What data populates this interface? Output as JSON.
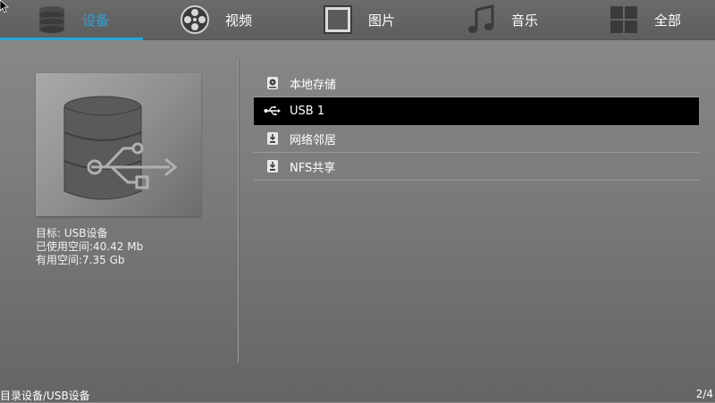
{
  "tabs": [
    {
      "label": "设备",
      "icon": "database-icon",
      "active": true
    },
    {
      "label": "视频",
      "icon": "film-reel-icon",
      "active": false
    },
    {
      "label": "图片",
      "icon": "picture-frame-icon",
      "active": false
    },
    {
      "label": "音乐",
      "icon": "music-note-icon",
      "active": false
    },
    {
      "label": "全部",
      "icon": "grid-icon",
      "active": false
    }
  ],
  "device": {
    "icon": "usb-storage-icon",
    "target": "目标: USB设备",
    "used": "已使用空间:40.42 Mb",
    "free": "有用空间:7.35 Gb"
  },
  "list": {
    "items": [
      {
        "label": "本地存储",
        "icon": "hard-disk-icon"
      },
      {
        "label": "USB 1",
        "icon": "usb-icon",
        "selected": true
      },
      {
        "label": "网络邻居",
        "icon": "network-share-icon"
      },
      {
        "label": "NFS共享",
        "icon": "nfs-share-icon"
      }
    ]
  },
  "status": {
    "path": "目录设备/USB设备",
    "page": "2/4"
  },
  "colors": {
    "accent": "#2aa2d8",
    "selected_row": "#000000"
  }
}
